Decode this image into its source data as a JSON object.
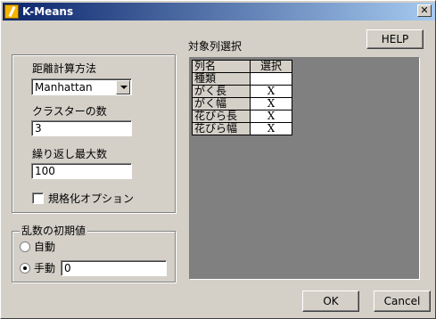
{
  "window": {
    "title": "K-Means",
    "close_glyph": "✕"
  },
  "buttons": {
    "help": "HELP",
    "ok": "OK",
    "cancel": "Cancel"
  },
  "distance": {
    "label": "距離計算方法",
    "selected": "Manhattan"
  },
  "clusters": {
    "label": "クラスターの数",
    "value": "3"
  },
  "iterations": {
    "label": "繰り返し最大数",
    "value": "100"
  },
  "normalize": {
    "label": "規格化オプション",
    "checked": false
  },
  "seed": {
    "group_label": "乱数の初期値",
    "auto_label": "自動",
    "manual_label": "手動",
    "manual_value": "0",
    "selected": "manual"
  },
  "columns": {
    "label": "対象列選択",
    "headers": [
      "列名",
      "選択"
    ],
    "rows": [
      {
        "name": "種類",
        "selected": ""
      },
      {
        "name": "がく長",
        "selected": "X"
      },
      {
        "name": "がく幅",
        "selected": "X"
      },
      {
        "name": "花びら長",
        "selected": "X"
      },
      {
        "name": "花びら幅",
        "selected": "X"
      }
    ]
  },
  "colors": {
    "titlebar_start": "#0a246a",
    "titlebar_end": "#a6caf0",
    "dialog_bg": "#d4d0c8",
    "grid_bg": "#808080"
  }
}
